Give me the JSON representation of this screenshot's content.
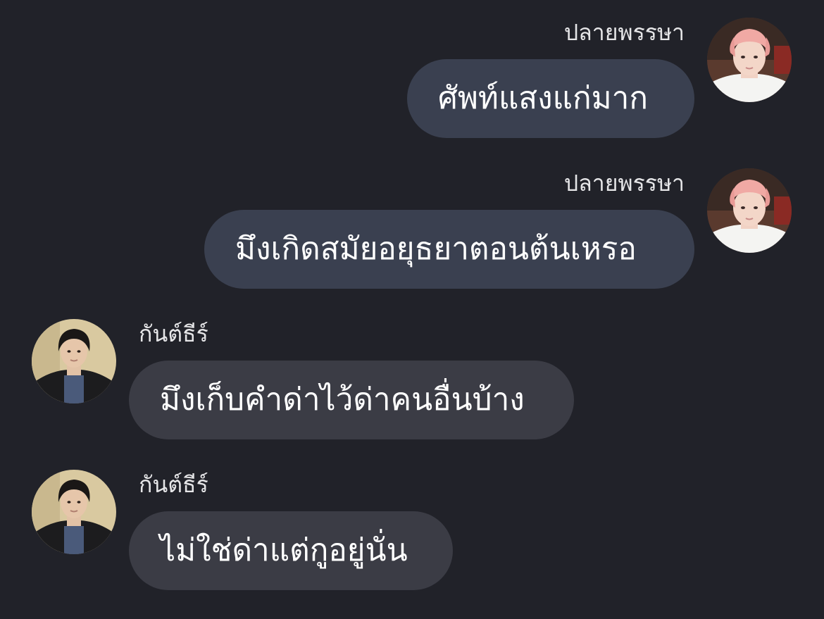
{
  "messages": [
    {
      "direction": "outgoing",
      "sender": "ปลายพรรษา",
      "text": "ศัพท์แสงแก่มาก",
      "avatar": "avatar-pink-hair"
    },
    {
      "direction": "outgoing",
      "sender": "ปลายพรรษา",
      "text": "มึงเกิดสมัยอยุธยาตอนต้นเหรอ",
      "avatar": "avatar-pink-hair"
    },
    {
      "direction": "incoming",
      "sender": "กันต์ธีร์",
      "text": "มึงเก็บคำด่าไว้ด่าคนอื่นบ้าง",
      "avatar": "avatar-dark-hair"
    },
    {
      "direction": "incoming",
      "sender": "กันต์ธีร์",
      "text": "ไม่ใช่ด่าแต่กูอยู่นั่น",
      "avatar": "avatar-dark-hair"
    }
  ],
  "colors": {
    "background": "#212229",
    "outgoing_bubble": "#3a4050",
    "incoming_bubble": "#3b3c45",
    "message_text": "#ffffff",
    "sender_text": "#e6e6e8"
  }
}
